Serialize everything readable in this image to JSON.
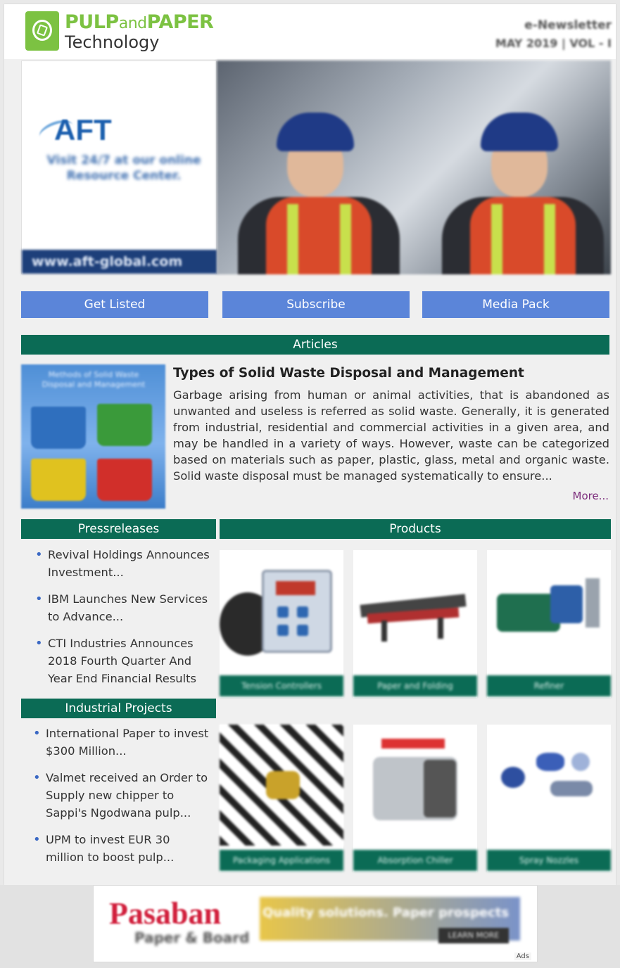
{
  "header": {
    "brand_pulp": "PULP",
    "brand_and": "and",
    "brand_paper": "PAPER",
    "brand_sub": "Technology",
    "issue_type": "e-Newsletter",
    "issue_date": "MAY 2019 | VOL - I"
  },
  "banner": {
    "ad_brand": "AFT",
    "ad_text": "Visit 24/7 at our online Resource Center.",
    "ad_url": "www.aft-global.com"
  },
  "nav": {
    "get_listed": "Get Listed",
    "subscribe": "Subscribe",
    "media_pack": "Media Pack"
  },
  "articles": {
    "heading": "Articles",
    "image_caption": "Methods of Solid Waste Disposal and Management",
    "title": "Types of Solid Waste Disposal and Management",
    "body": "Garbage arising from human or animal activities, that is abandoned as unwanted and useless is referred as solid waste. Generally, it is generated from industrial, residential and commercial activities in a given area, and may be handled in a variety of ways. However, waste can be categorized based on materials such as paper, plastic, glass, metal and organic waste. Solid waste disposal must be managed systematically to ensure...",
    "more": "More..."
  },
  "pressreleases": {
    "heading": "Pressreleases",
    "items": [
      "Revival Holdings Announces Investment...",
      "IBM Launches New Services to Advance...",
      "CTI Industries Announces 2018 Fourth Quarter And Year End Financial Results"
    ]
  },
  "projects": {
    "heading": "Industrial Projects",
    "items": [
      "International Paper to invest $300 Million...",
      "Valmet received an Order to Supply new chipper to Sappi's Ngodwana pulp...",
      "UPM to invest EUR 30 million to boost pulp..."
    ]
  },
  "products": {
    "heading": "Products",
    "items": [
      {
        "label": "Tension Controllers"
      },
      {
        "label": "Paper and Folding"
      },
      {
        "label": "Refiner"
      },
      {
        "label": "Packaging Applications"
      },
      {
        "label": "Absorption Chiller"
      },
      {
        "label": "Spray Nozzles"
      }
    ]
  },
  "bottom_ad": {
    "brand": "Pasaban",
    "sub": "Paper & Board",
    "tagline": "Quality solutions. Paper prospects",
    "cta": "LEARN MORE",
    "ads_label": "Ads"
  },
  "colors": {
    "brand_green": "#7cc242",
    "section_green": "#0b6b55",
    "button_blue": "#5b85d9",
    "link_purple": "#7b2b7b"
  }
}
